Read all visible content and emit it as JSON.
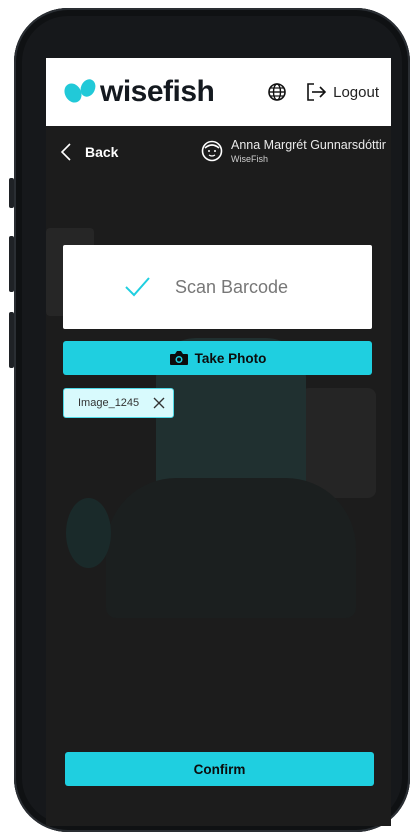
{
  "header": {
    "logo_text": "wisefish",
    "logout_label": "Logout",
    "icons": [
      "globe-icon",
      "logout-icon"
    ]
  },
  "nav": {
    "back_label": "Back",
    "user_name": "Anna Margrét Gunnarsdóttir",
    "user_org": "WiseFish"
  },
  "scan": {
    "label": "Scan Barcode",
    "status": "checked"
  },
  "photo": {
    "label": "Take Photo"
  },
  "attachments": [
    {
      "name": "Image_1245"
    }
  ],
  "confirm": {
    "label": "Confirm"
  },
  "colors": {
    "accent": "#1fcfe0",
    "chip_bg": "#d8fafd",
    "screen_bg": "#1c1c1c",
    "logo_dark": "#14191f"
  }
}
